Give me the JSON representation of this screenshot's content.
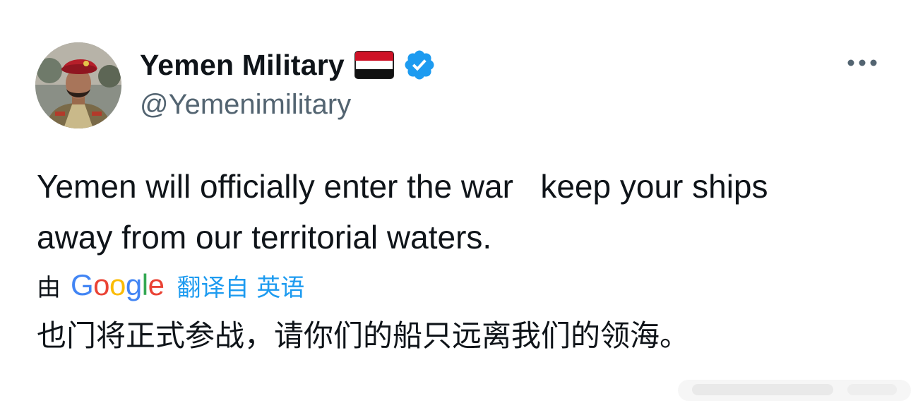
{
  "author": {
    "display_name": "Yemen Military",
    "handle": "@Yemenimilitary",
    "flag_icon": "yemen-flag-icon",
    "verified_icon": "verified-badge-icon",
    "verified_color": "#1d9bf0"
  },
  "menu": {
    "icon": "more-horizontal-icon"
  },
  "tweet": {
    "lines": [
      "Yemen will officially enter the war   keep your ships",
      "away from our territorial waters."
    ]
  },
  "translation": {
    "by_label": "由",
    "provider": "Google",
    "link_label": "翻译自 英语",
    "text": "也门将正式参战，请你们的船只远离我们的领海。"
  },
  "colors": {
    "text": "#0f1419",
    "secondary": "#536471",
    "link": "#1d9bf0",
    "google_blue": "#4285f4",
    "google_red": "#ea4335",
    "google_yellow": "#fbbc05",
    "google_green": "#34a853"
  }
}
